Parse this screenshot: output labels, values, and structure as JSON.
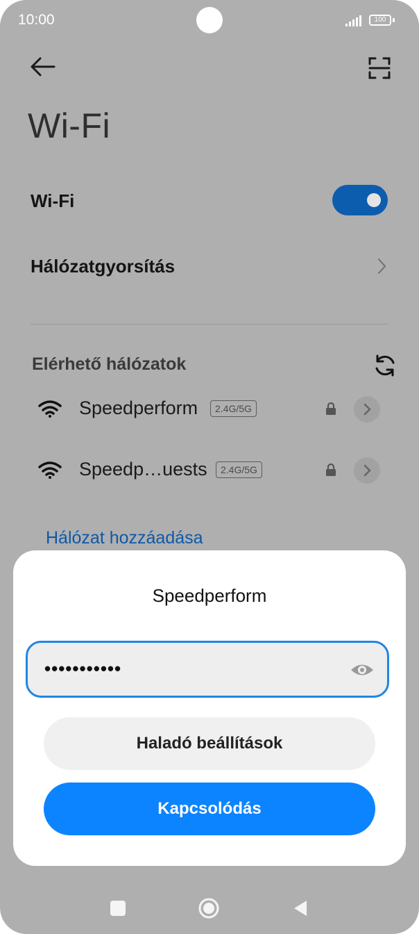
{
  "status_bar": {
    "time": "10:00",
    "battery": "100",
    "signal_icon": "signal-bars-icon"
  },
  "header": {
    "back_icon": "arrow-left-icon",
    "scan_icon": "qr-scan-icon",
    "title": "Wi-Fi"
  },
  "settings": {
    "wifi_label": "Wi-Fi",
    "wifi_enabled": true,
    "acceleration_label": "Hálózatgyorsítás"
  },
  "networks": {
    "section_label": "Elérhető hálózatok",
    "items": [
      {
        "name": "Speedperform",
        "band": "2.4G/5G",
        "secured": true
      },
      {
        "name": "Speedp…uests",
        "band": "2.4G/5G",
        "secured": true
      }
    ],
    "add_network_label": "Hálózat hozzáadása"
  },
  "dialog": {
    "title": "Speedperform",
    "password_value": "•••••••••••",
    "advanced_label": "Haladó beállítások",
    "connect_label": "Kapcsolódás"
  },
  "colors": {
    "toggle_on": "#0d5dae",
    "link": "#0e58a8",
    "primary_button": "#0d84ff",
    "field_focus_border": "#1f86e4"
  }
}
